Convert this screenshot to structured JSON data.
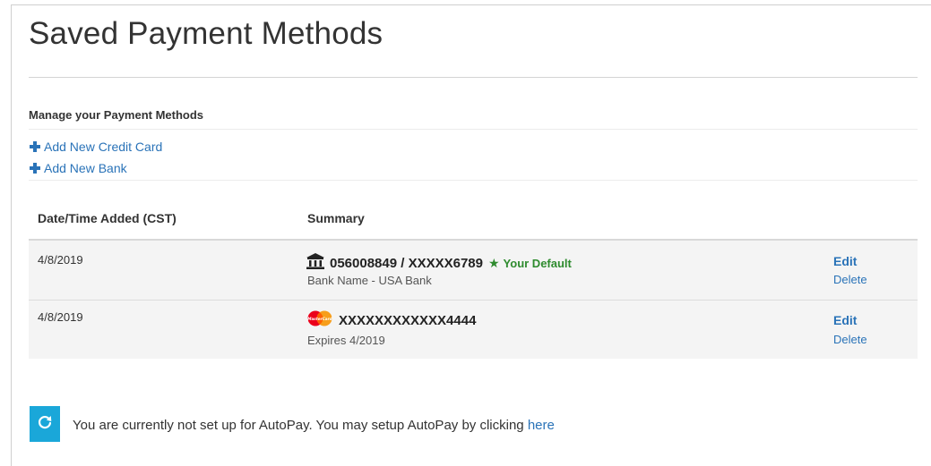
{
  "page": {
    "title": "Saved Payment Methods",
    "section_heading": "Manage your Payment Methods"
  },
  "actions": {
    "add_credit_card": "Add New Credit Card",
    "add_bank": "Add New Bank"
  },
  "table": {
    "columns": [
      "Date/Time Added (CST)",
      "Summary"
    ],
    "rows": [
      {
        "date": "4/8/2019",
        "type_icon": "bank-icon",
        "summary": "056008849 / XXXXX6789",
        "default_label": "Your Default",
        "detail": "Bank Name - USA Bank",
        "edit_label": "Edit",
        "delete_label": "Delete"
      },
      {
        "date": "4/8/2019",
        "type_icon": "mastercard-icon",
        "card_logo_text": "MasterCard",
        "summary": "XXXXXXXXXXXX4444",
        "detail": "Expires 4/2019",
        "edit_label": "Edit",
        "delete_label": "Delete"
      }
    ]
  },
  "autopay": {
    "icon": "refresh-icon",
    "message": "You are currently not set up for AutoPay. You may setup AutoPay by clicking ",
    "link_label": "here"
  },
  "colors": {
    "link": "#2a73b8",
    "default_green": "#2e8b2e",
    "autopay_button": "#1aa7d9",
    "row_background": "#f4f4f4"
  }
}
